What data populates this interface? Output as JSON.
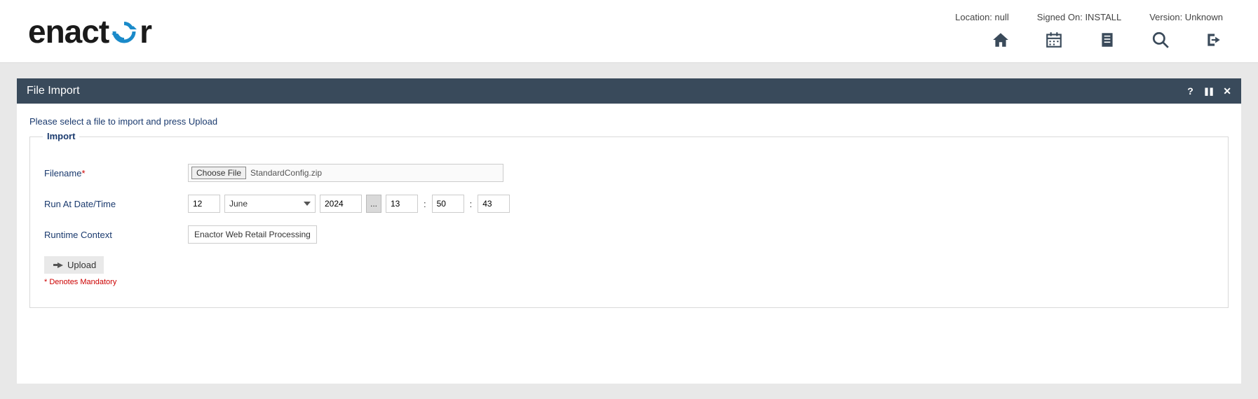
{
  "header": {
    "logo_pre": "enact",
    "logo_post": "r",
    "location_label": "Location: null",
    "signed_on_label": "Signed On: INSTALL",
    "version_label": "Version: Unknown"
  },
  "panel": {
    "title": "File Import",
    "help_glyph": "?",
    "pause_glyph": "❚❚",
    "close_glyph": "✕"
  },
  "instruction": "Please select a file to import and press Upload",
  "fieldset": {
    "legend": "Import",
    "filename_label": "Filename",
    "choose_label": "Choose File",
    "filename_value": "StandardConfig.zip",
    "run_at_label": "Run At Date/Time",
    "day": "12",
    "month": "June",
    "year": "2024",
    "date_picker_glyph": "...",
    "hour": "13",
    "minute": "50",
    "second": "43",
    "runtime_label": "Runtime Context",
    "runtime_value": "Enactor Web Retail Processing",
    "upload_label": "Upload",
    "mandatory_note": "* Denotes Mandatory",
    "asterisk": "*",
    "colon": ":"
  }
}
